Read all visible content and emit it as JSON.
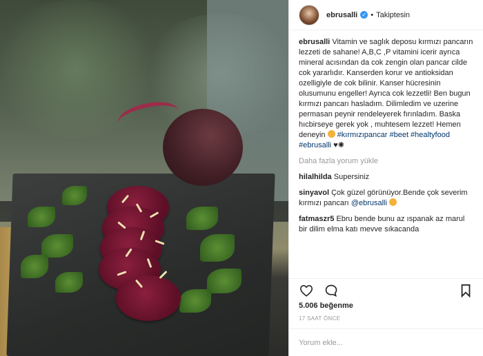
{
  "post": {
    "username": "ebrusalli",
    "follow_status": "Takiptesin",
    "separator": "•"
  },
  "caption": {
    "username": "ebrusalli",
    "text": "Vitamin ve saglık deposu kırmızı pancarın lezzeti de sahane! A,B,C ,P vitamini icerir ayrıca mineral acısından da cok zengin olan pancar cilde cok yararlıdır. Kanserden korur ve antioksidan ozelligiyle de cok bilinir. Kanser hücresinin olusumunu engeller! Ayrıca cok lezzetli! Ben bugun kırmızı pancarı hasladım. Dilimledim ve uzerine permasan peynir rendeleyerek fırınladım. Baska hıcbirseye gerek yok , muhtesem lezzet! Hemen deneyin",
    "hashtags": "#kırmızıpancar #beet #healtyfood",
    "mention": "#ebrusalli"
  },
  "load_more": "Daha fazla yorum yükle",
  "comments": [
    {
      "user": "hilalhilda",
      "text": "Supersiniz"
    },
    {
      "user": "sinyavol",
      "text": "Çok güzel görünüyor.Bende çok severim kırmızı pancarı",
      "mention": "@ebrusalli"
    },
    {
      "user": "fatmaszr5",
      "text": "Ebru bende bunu az ıspanak az marul bir dilim elma katı mevve sıkacanda"
    }
  ],
  "likes": "5.006 beğenme",
  "time_ago": "17 SAAT ÖNCE",
  "comment_input": {
    "placeholder": "Yorum ekle..."
  },
  "icons": {
    "like": "heart-icon",
    "comment": "comment-bubble-icon",
    "bookmark": "bookmark-icon",
    "verified": "verified-badge-icon"
  },
  "colors": {
    "link": "#003569",
    "verified": "#3897f0",
    "muted": "#999999"
  }
}
